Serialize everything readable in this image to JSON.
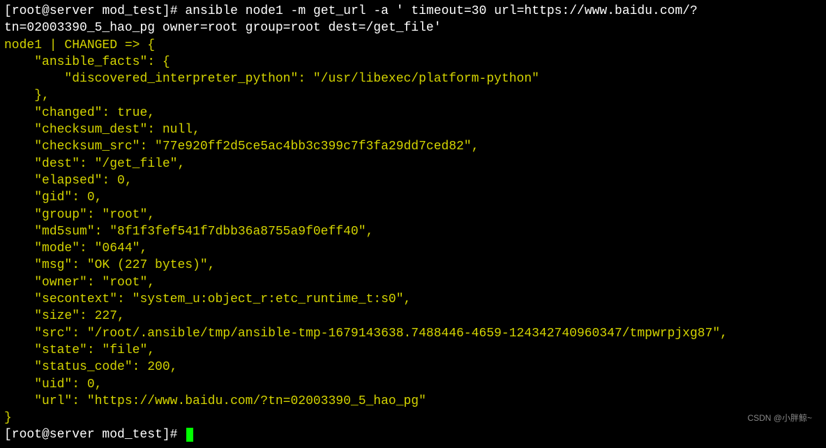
{
  "terminal": {
    "prompt_user": "root",
    "prompt_host": "server",
    "prompt_dir": "mod_test",
    "prompt_symbol": "#",
    "command": "ansible node1 -m get_url -a ' timeout=30 url=https://www.baidu.com/?tn=02003390_5_hao_pg owner=root group=root dest=/get_file'",
    "output": {
      "host_status": "node1 | CHANGED => {",
      "ansible_facts_key": "\"ansible_facts\": {",
      "discovered_interpreter_line": "        \"discovered_interpreter_python\": \"/usr/libexec/platform-python\"",
      "close_facts": "    },",
      "changed_line": "    \"changed\": true,",
      "checksum_dest_line": "    \"checksum_dest\": null,",
      "checksum_src_line": "    \"checksum_src\": \"77e920ff2d5ce5ac4bb3c399c7f3fa29dd7ced82\",",
      "dest_line": "    \"dest\": \"/get_file\",",
      "elapsed_line": "    \"elapsed\": 0,",
      "gid_line": "    \"gid\": 0,",
      "group_line": "    \"group\": \"root\",",
      "md5sum_line": "    \"md5sum\": \"8f1f3fef541f7dbb36a8755a9f0eff40\",",
      "mode_line": "    \"mode\": \"0644\",",
      "msg_line": "    \"msg\": \"OK (227 bytes)\",",
      "owner_line": "    \"owner\": \"root\",",
      "secontext_line": "    \"secontext\": \"system_u:object_r:etc_runtime_t:s0\",",
      "size_line": "    \"size\": 227,",
      "src_line": "    \"src\": \"/root/.ansible/tmp/ansible-tmp-1679143638.7488446-4659-124342740960347/tmpwrpjxg87\",",
      "state_line": "    \"state\": \"file\",",
      "status_code_line": "    \"status_code\": 200,",
      "uid_line": "    \"uid\": 0,",
      "url_line": "    \"url\": \"https://www.baidu.com/?tn=02003390_5_hao_pg\"",
      "close_brace": "}"
    },
    "prompt2_prefix": "[root@server mod_test]# "
  },
  "watermark": "CSDN @小胖鲸~"
}
